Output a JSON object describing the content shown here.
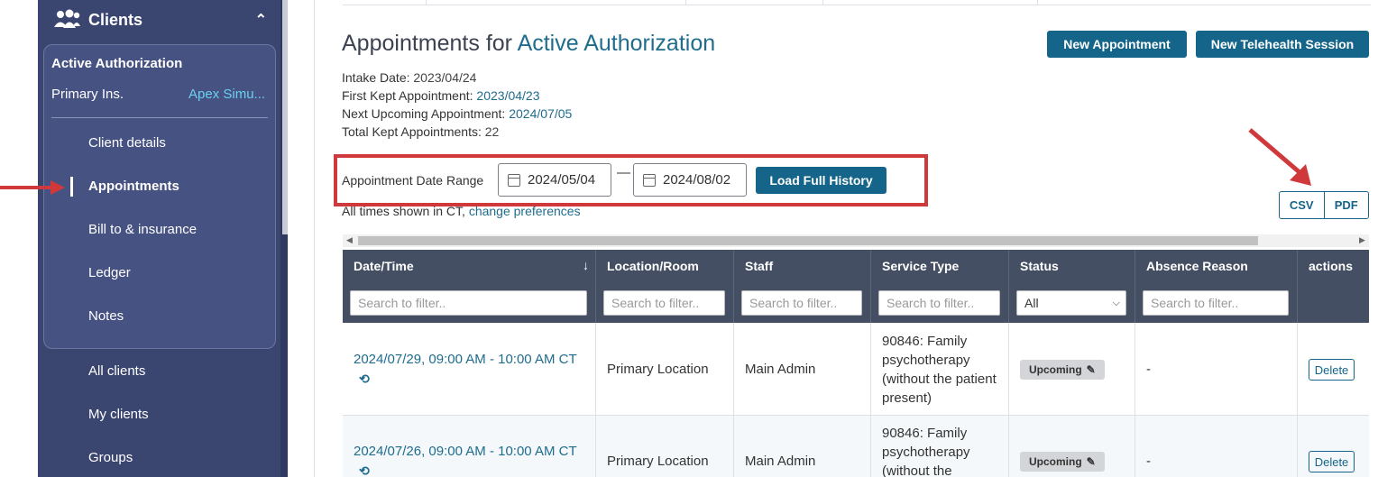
{
  "sidebar": {
    "section_title": "Clients",
    "client_box": {
      "title": "Active Authorization",
      "primary_ins_label": "Primary Ins.",
      "primary_ins_value": "Apex Simu..."
    },
    "items": [
      {
        "label": "Client details"
      },
      {
        "label": "Appointments"
      },
      {
        "label": "Bill to & insurance"
      },
      {
        "label": "Ledger"
      },
      {
        "label": "Notes"
      }
    ],
    "more_items": [
      {
        "label": "All clients"
      },
      {
        "label": "My clients"
      },
      {
        "label": "Groups"
      }
    ]
  },
  "header": {
    "title_prefix": "Appointments for ",
    "title_accent": "Active Authorization",
    "new_appointment": "New Appointment",
    "new_telehealth": "New Telehealth Session"
  },
  "summary": {
    "intake_label": "Intake Date:",
    "intake_value": "2023/04/24",
    "first_kept_label": "First Kept Appointment:",
    "first_kept_value": "2023/04/23",
    "next_upcoming_label": "Next Upcoming Appointment:",
    "next_upcoming_value": "2024/07/05",
    "total_kept_label": "Total Kept Appointments:",
    "total_kept_value": "22"
  },
  "date_range": {
    "label": "Appointment Date Range",
    "start": "2024/05/04",
    "separator": "—",
    "end": "2024/08/02",
    "load_button": "Load Full History",
    "tz_note": "All times shown in CT,",
    "change_prefs": "change preferences"
  },
  "export": {
    "csv": "CSV",
    "pdf": "PDF"
  },
  "table": {
    "columns": [
      "Date/Time",
      "Location/Room",
      "Staff",
      "Service Type",
      "Status",
      "Absence Reason",
      "actions"
    ],
    "filter_placeholder": "Search to filter..",
    "status_filter": "All",
    "rows": [
      {
        "datetime": "2024/07/29, 09:00 AM - 10:00 AM CT",
        "location": "Primary Location",
        "staff": "Main Admin",
        "service": "90846: Family psychotherapy (without the patient present)",
        "status": "Upcoming",
        "absence": "-",
        "action": "Delete"
      },
      {
        "datetime": "2024/07/26, 09:00 AM - 10:00 AM CT",
        "location": "Primary Location",
        "staff": "Main Admin",
        "service": "90846: Family psychotherapy (without the",
        "status": "Upcoming",
        "absence": "-",
        "action": "Delete"
      }
    ]
  }
}
